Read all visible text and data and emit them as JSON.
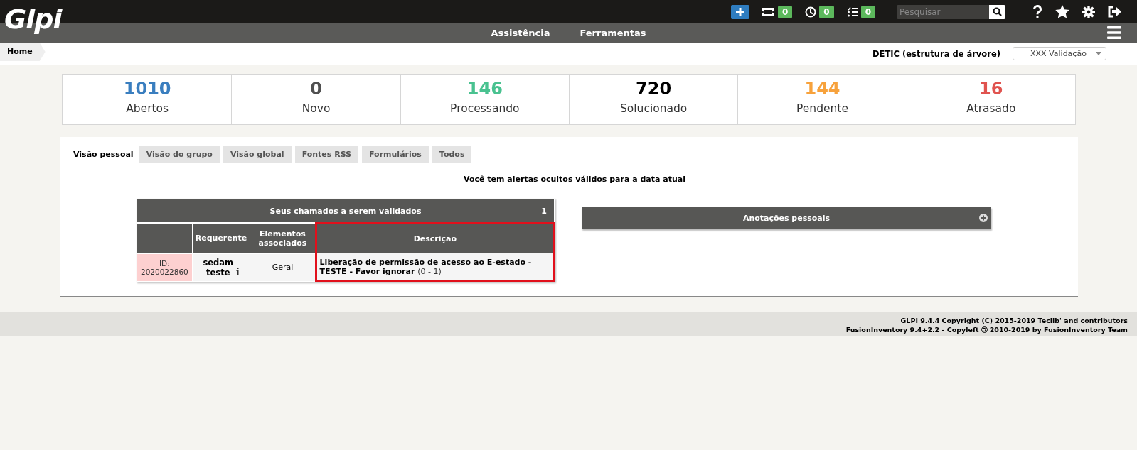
{
  "header": {
    "logo": "Glpi",
    "counters": [
      {
        "kind": "ticket",
        "count": "0"
      },
      {
        "kind": "clock",
        "count": "0"
      },
      {
        "kind": "tasks",
        "count": "0"
      }
    ],
    "search": {
      "placeholder": "Pesquisar"
    }
  },
  "menu": [
    "Assistência",
    "Ferramentas"
  ],
  "breadcrumb": "Home",
  "entity": {
    "label": "DETIC (estrutura de árvore)",
    "value": "XXX Validação"
  },
  "stats": [
    {
      "value": "1010",
      "label": "Abertos",
      "color": "#3a7ebf"
    },
    {
      "value": "0",
      "label": "Novo",
      "color": "#505050"
    },
    {
      "value": "146",
      "label": "Processando",
      "color": "#49c290"
    },
    {
      "value": "720",
      "label": "Solucionado",
      "color": "#000000"
    },
    {
      "value": "144",
      "label": "Pendente",
      "color": "#f7a23c"
    },
    {
      "value": "16",
      "label": "Atrasado",
      "color": "#e0534f"
    }
  ],
  "tabs": [
    {
      "label": "Visão pessoal",
      "selected": true
    },
    {
      "label": "Visão do grupo",
      "selected": false
    },
    {
      "label": "Visão global",
      "selected": false
    },
    {
      "label": "Fontes RSS",
      "selected": false
    },
    {
      "label": "Formulários",
      "selected": false
    },
    {
      "label": "Todos",
      "selected": false
    }
  ],
  "alert": "Você tem alertas ocultos válidos para a data atual",
  "validation_table": {
    "title": "Seus chamados a serem validados",
    "count": "1",
    "columns": [
      {
        "label": "Requerente",
        "highlighted": false
      },
      {
        "label": "Elementos associados",
        "highlighted": false
      },
      {
        "label": "Descrição",
        "highlighted": true
      }
    ],
    "rows": [
      {
        "id": "ID: 2020022860",
        "requester": "sedam teste",
        "items": "Geral",
        "description": "Liberação de permissão de acesso ao E-estado - TESTE - Favor ignorar",
        "counter": "(0 - 1)"
      }
    ]
  },
  "notes": {
    "title": "Anotações pessoais"
  },
  "footer": {
    "line_1": "GLPI 9.4.4 Copyright (C) 2015-2019 Teclib' and contributors",
    "line_2_before": "FusionInventory 9.4+2.2 - Copyleft",
    "line_2_after": "2010-2019 by FusionInventory Team"
  }
}
